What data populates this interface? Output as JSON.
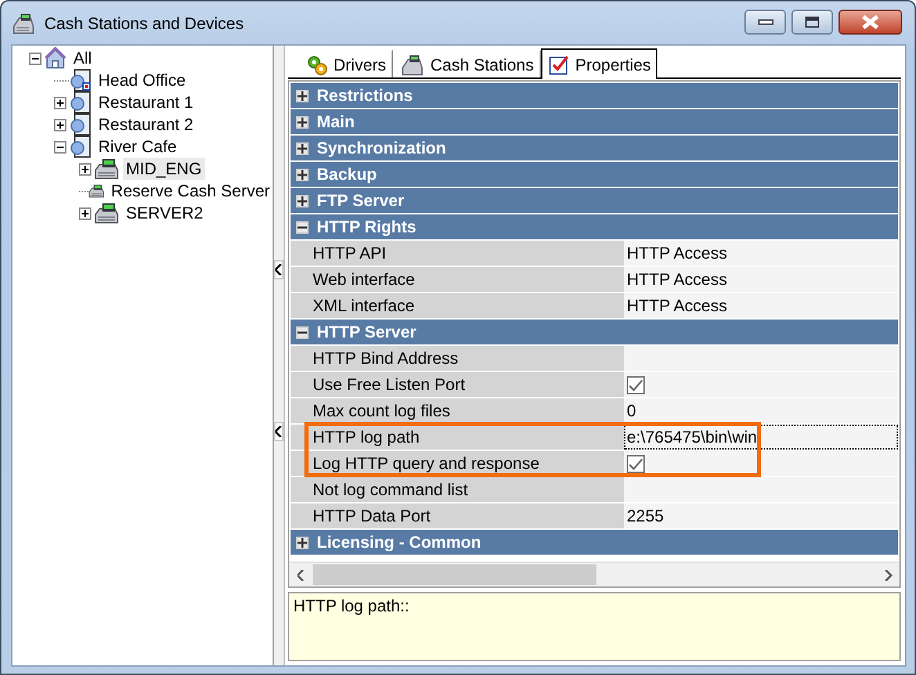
{
  "window": {
    "title": "Cash Stations and Devices"
  },
  "tree": [
    {
      "label": "All",
      "kind": "root",
      "expanded": true,
      "selected": false,
      "children": [
        {
          "label": "Head Office",
          "kind": "office",
          "selected": false
        },
        {
          "label": "Restaurant 1",
          "kind": "site",
          "expanded": false,
          "selected": false
        },
        {
          "label": "Restaurant 2",
          "kind": "site",
          "expanded": false,
          "selected": false
        },
        {
          "label": "River Cafe",
          "kind": "site",
          "expanded": true,
          "selected": false,
          "children": [
            {
              "label": "MID_ENG",
              "kind": "server",
              "expanded": false,
              "selected": true
            },
            {
              "label": "Reserve Cash Server",
              "kind": "server",
              "selected": false
            },
            {
              "label": "SERVER2",
              "kind": "server",
              "expanded": false,
              "selected": false
            }
          ]
        }
      ]
    }
  ],
  "tabs": [
    {
      "label": "Drivers",
      "kind": "drivers",
      "selected": false
    },
    {
      "label": "Cash Stations",
      "kind": "stations",
      "selected": false
    },
    {
      "label": "Properties",
      "kind": "properties",
      "selected": true
    }
  ],
  "property_grid": {
    "categories": [
      {
        "name": "Restrictions",
        "expanded": false
      },
      {
        "name": "Main",
        "expanded": false
      },
      {
        "name": "Synchronization",
        "expanded": false
      },
      {
        "name": "Backup",
        "expanded": false
      },
      {
        "name": "FTP Server",
        "expanded": false
      },
      {
        "name": "HTTP Rights",
        "expanded": true,
        "properties": [
          {
            "name": "HTTP API",
            "kind": "text",
            "value": "HTTP Access",
            "selected": false,
            "highlighted": false
          },
          {
            "name": "Web interface",
            "kind": "text",
            "value": "HTTP Access",
            "selected": false,
            "highlighted": false
          },
          {
            "name": "XML interface",
            "kind": "text",
            "value": "HTTP Access",
            "selected": false,
            "highlighted": false
          }
        ]
      },
      {
        "name": "HTTP Server",
        "expanded": true,
        "properties": [
          {
            "name": "HTTP Bind Address",
            "kind": "text",
            "selected": false,
            "highlighted": false
          },
          {
            "name": "Use Free Listen Port",
            "kind": "checkbox",
            "checked": true,
            "selected": false,
            "highlighted": false
          },
          {
            "name": "Max count log files",
            "kind": "text",
            "value": "0",
            "selected": false,
            "highlighted": false
          },
          {
            "name": "HTTP log path",
            "kind": "text",
            "value": "e:\\765475\\bin\\win",
            "selected": true,
            "highlighted": true
          },
          {
            "name": "Log HTTP query and response",
            "kind": "checkbox",
            "checked": true,
            "selected": false,
            "highlighted": true
          },
          {
            "name": "Not log command list",
            "kind": "text",
            "selected": false,
            "highlighted": false
          },
          {
            "name": "HTTP Data Port",
            "kind": "text",
            "value": "2255",
            "selected": false,
            "highlighted": false
          }
        ]
      },
      {
        "name": "Licensing - Common",
        "expanded": false
      }
    ]
  },
  "description": "HTTP log path::"
}
